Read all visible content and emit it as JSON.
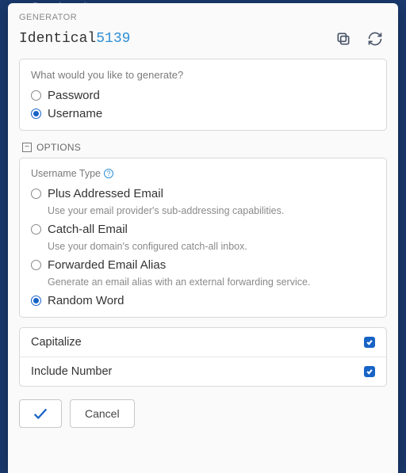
{
  "backdrop_text": "Search vault",
  "modal_title": "GENERATOR",
  "generated": {
    "word": "Identical",
    "number": "5139"
  },
  "gen_prompt": "What would you like to generate?",
  "gen_types": [
    {
      "label": "Password",
      "selected": false
    },
    {
      "label": "Username",
      "selected": true
    }
  ],
  "options_title": "OPTIONS",
  "username_type_label": "Username Type",
  "username_types": [
    {
      "label": "Plus Addressed Email",
      "desc": "Use your email provider's sub-addressing capabilities.",
      "selected": false
    },
    {
      "label": "Catch-all Email",
      "desc": "Use your domain's configured catch-all inbox.",
      "selected": false
    },
    {
      "label": "Forwarded Email Alias",
      "desc": "Generate an email alias with an external forwarding service.",
      "selected": false
    },
    {
      "label": "Random Word",
      "desc": "",
      "selected": true
    }
  ],
  "toggles": {
    "capitalize": {
      "label": "Capitalize",
      "checked": true
    },
    "include_number": {
      "label": "Include Number",
      "checked": true
    }
  },
  "buttons": {
    "cancel": "Cancel"
  }
}
